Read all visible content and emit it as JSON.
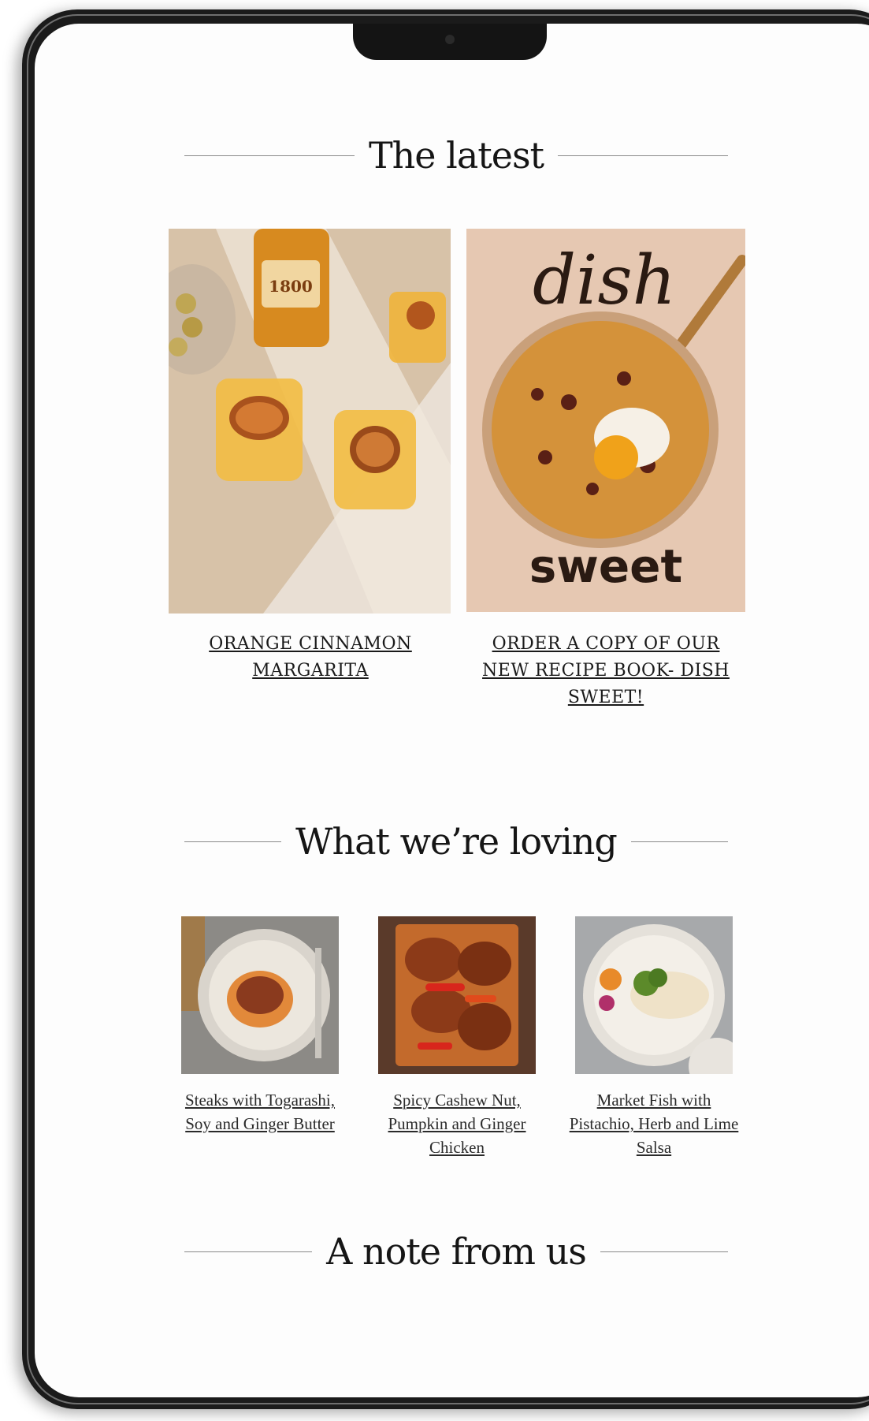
{
  "sections": {
    "latest": {
      "title": "The latest"
    },
    "loving": {
      "title": "What we’re loving"
    },
    "note": {
      "title": "A note from us"
    }
  },
  "latest": {
    "items": [
      {
        "caption": "ORANGE CINNAMON MARGARITA",
        "image_alt": "orange cinnamon margarita cocktails with 1800 tequila bottle",
        "bottle_label": "1800"
      },
      {
        "caption": "ORDER A COPY OF OUR NEW RECIPE BOOK- DISH SWEET!",
        "image_alt": "Dish Sweet recipe book cover with pan dessert",
        "cover_top": "dish",
        "cover_bottom": "sweet"
      }
    ]
  },
  "loving": {
    "items": [
      {
        "caption": "Steaks with Togarashi, Soy and Ginger Butter"
      },
      {
        "caption": "Spicy Cashew Nut, Pumpkin and Ginger Chicken"
      },
      {
        "caption": "Market Fish with Pistachio, Herb and Lime Salsa"
      }
    ]
  },
  "colors": {
    "background": "#fdfdfd",
    "text": "#1a1a1a",
    "rule": "#8a8a8a",
    "device_frame": "#1b1b1b"
  }
}
